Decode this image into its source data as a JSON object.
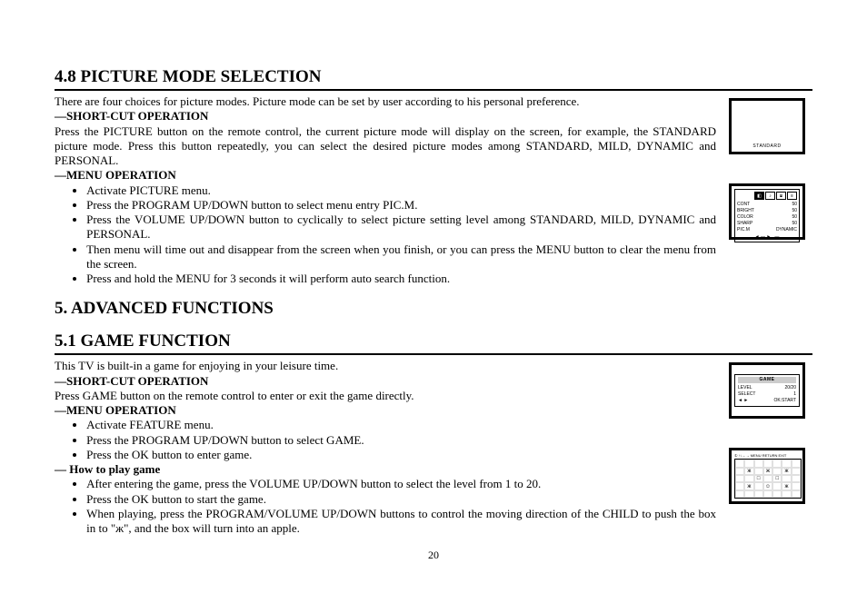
{
  "section48": {
    "heading": "4.8 PICTURE MODE SELECTION",
    "intro": "There are four choices for picture modes. Picture mode can be set by user according to his personal preference.",
    "shortcut_label": "SHORT-CUT OPERATION",
    "shortcut_text": "Press the PICTURE button on the remote control, the current picture mode will display on the screen, for example, the STANDARD picture mode. Press this button repeatedly, you can select the desired picture modes among STANDARD, MILD, DYNAMIC and PERSONAL.",
    "menu_label": "MENU OPERATION",
    "bullets": [
      "Activate PICTURE menu.",
      "Press the PROGRAM UP/DOWN button to select menu entry PIC.M.",
      "Press the VOLUME UP/DOWN button to cyclically to select picture setting level among STANDARD, MILD, DYNAMIC and PERSONAL.",
      "Then menu will time out and disappear from the screen when you finish, or you can press the MENU button to clear the menu from the screen.",
      "Press and hold the MENU for 3 seconds it will perform auto search function."
    ],
    "tv_standard_label": "STANDARD",
    "picture_menu": {
      "rows": [
        {
          "k": "CONT",
          "v": "50"
        },
        {
          "k": "BRIGHT",
          "v": "50"
        },
        {
          "k": "COLOR",
          "v": "50"
        },
        {
          "k": "SHARP",
          "v": "50"
        },
        {
          "k": "PIC.M",
          "v": "DYNAMIC"
        }
      ],
      "footer_left": "◄ — ►",
      "footer_right": "—"
    }
  },
  "section5": {
    "heading": "5.   ADVANCED FUNCTIONS"
  },
  "section51": {
    "heading": "5.1 GAME FUNCTION",
    "intro": "This TV is built-in a game for enjoying in your leisure time.",
    "shortcut_label": "SHORT-CUT OPERATION",
    "shortcut_text": "Press GAME button on the remote control to enter or exit the game directly.",
    "menu_label": "MENU OPERATION",
    "menu_bullets": [
      "Activate FEATURE menu.",
      "Press the PROGRAM UP/DOWN button to select GAME.",
      "Press the OK button to enter game."
    ],
    "howto_label": "How to play game",
    "howto_bullets": [
      "After entering the game, press the VOLUME UP/DOWN button to select the level from 1 to 20.",
      "Press the OK button to start the game.",
      "When playing, press the PROGRAM/VOLUME UP/DOWN buttons to control the moving direction of the CHILD to push the box in to \"ж\", and the box will turn into an apple."
    ],
    "game_menu": {
      "title": "GAME",
      "level_k": "LEVEL",
      "level_v": "20/20",
      "select_k": "SELECT",
      "select_v": "1",
      "ok_k": "◄ ►",
      "ok_v": "OK:START"
    },
    "game_top": "① ↑↓←→  MENU  RETURN  EXIT"
  },
  "pagenum": "20"
}
